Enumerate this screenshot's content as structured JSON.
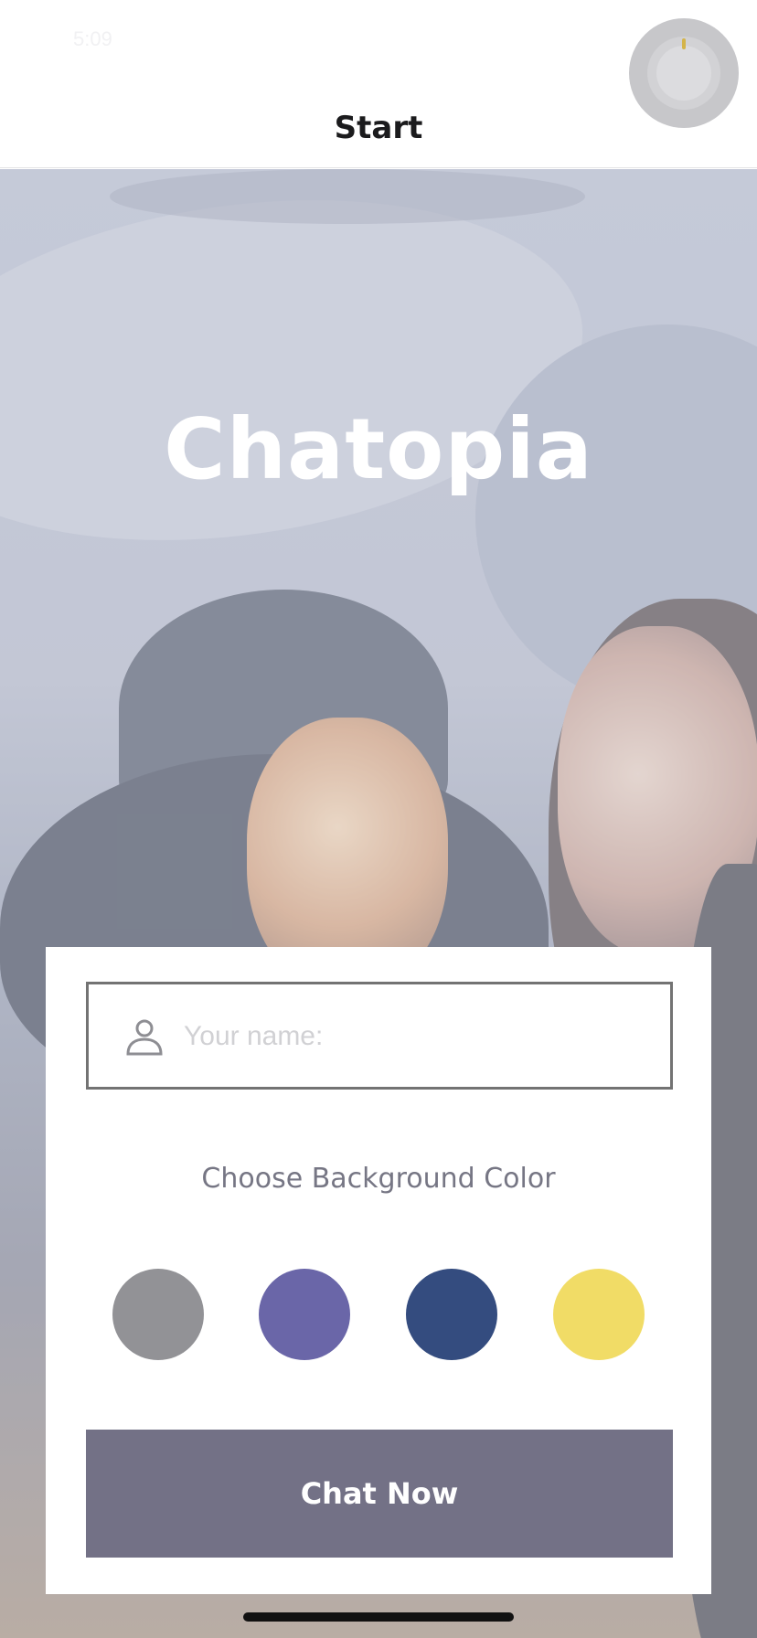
{
  "status_bar": {
    "time": "5:09"
  },
  "nav": {
    "title": "Start"
  },
  "hero": {
    "title": "Chatopia"
  },
  "form": {
    "name_placeholder": "Your name:",
    "name_value": "",
    "color_prompt": "Choose Background Color",
    "colors": [
      {
        "name": "gray",
        "hex": "#929296"
      },
      {
        "name": "purple",
        "hex": "#6a66a8"
      },
      {
        "name": "navy",
        "hex": "#344c7f"
      },
      {
        "name": "yellow",
        "hex": "#f1dc66"
      }
    ],
    "submit_label": "Chat Now",
    "submit_color": "#737186"
  },
  "icons": {
    "name_field": "person-icon",
    "assistive_touch": "assistive-touch-icon"
  }
}
